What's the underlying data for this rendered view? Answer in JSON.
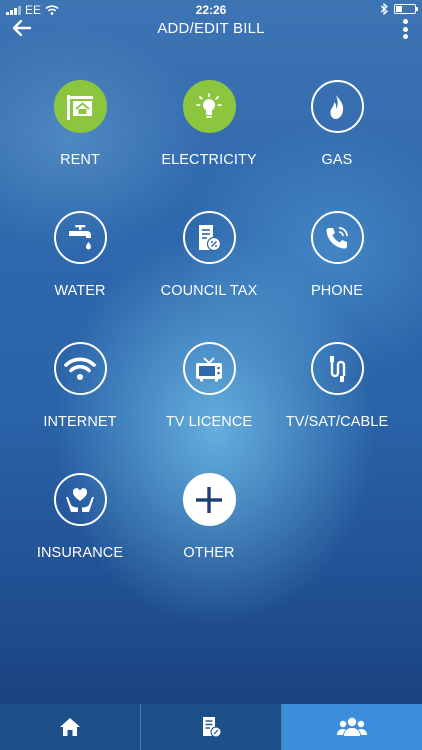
{
  "status_bar": {
    "carrier": "EE",
    "time": "22:26"
  },
  "header": {
    "title": "ADD/EDIT BILL"
  },
  "bill_types": [
    {
      "label": "RENT",
      "icon": "house-sign-icon",
      "style": "green"
    },
    {
      "label": "ELECTRICITY",
      "icon": "lightbulb-icon",
      "style": "green"
    },
    {
      "label": "GAS",
      "icon": "flame-icon",
      "style": "outline"
    },
    {
      "label": "WATER",
      "icon": "water-tap-icon",
      "style": "outline"
    },
    {
      "label": "COUNCIL TAX",
      "icon": "tax-document-icon",
      "style": "outline"
    },
    {
      "label": "PHONE",
      "icon": "phone-icon",
      "style": "outline"
    },
    {
      "label": "INTERNET",
      "icon": "wifi-icon",
      "style": "outline"
    },
    {
      "label": "TV LICENCE",
      "icon": "tv-icon",
      "style": "outline"
    },
    {
      "label": "TV/SAT/CABLE",
      "icon": "cable-icon",
      "style": "outline"
    },
    {
      "label": "INSURANCE",
      "icon": "heart-hands-icon",
      "style": "outline"
    },
    {
      "label": "OTHER",
      "icon": "plus-icon",
      "style": "filled-white"
    }
  ],
  "tab_bar": {
    "tabs": [
      {
        "icon": "home-icon",
        "active": false
      },
      {
        "icon": "bills-icon",
        "active": false
      },
      {
        "icon": "group-icon",
        "active": true
      }
    ]
  },
  "colors": {
    "accent_green": "#8cc63f",
    "active_tab": "#3a8edb",
    "tab_bar": "#1d4f88"
  }
}
